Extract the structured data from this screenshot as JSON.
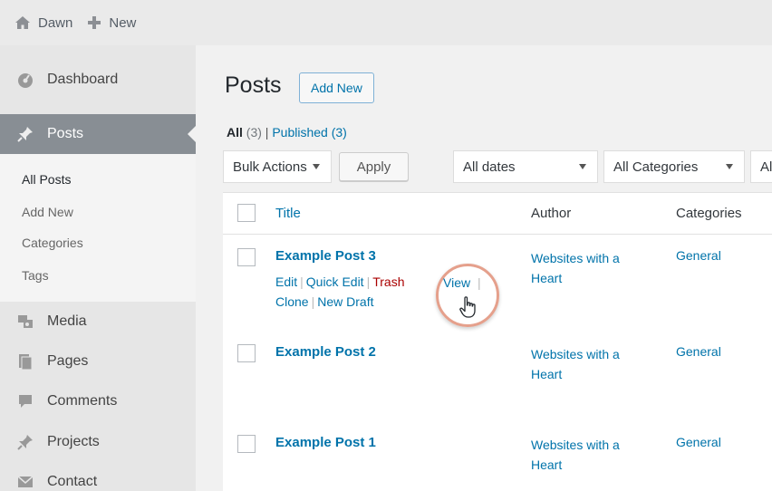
{
  "adminbar": {
    "site_name": "Dawn",
    "new_label": "New"
  },
  "sidebar": {
    "items": [
      {
        "label": "Dashboard",
        "icon": "dashboard-icon"
      },
      {
        "label": "Posts",
        "icon": "pin-icon",
        "current": true
      },
      {
        "label": "Media",
        "icon": "media-icon"
      },
      {
        "label": "Pages",
        "icon": "pages-icon"
      },
      {
        "label": "Comments",
        "icon": "comment-icon"
      },
      {
        "label": "Projects",
        "icon": "pin-icon"
      },
      {
        "label": "Contact",
        "icon": "mail-icon"
      }
    ],
    "submenu": [
      {
        "label": "All Posts",
        "current": true
      },
      {
        "label": "Add New"
      },
      {
        "label": "Categories"
      },
      {
        "label": "Tags"
      }
    ]
  },
  "main": {
    "title": "Posts",
    "add_new": "Add New",
    "views": {
      "all_label": "All",
      "all_count": "(3)",
      "separator": "|",
      "published_label": "Published",
      "published_count": "(3)"
    },
    "filters": {
      "bulk_actions": "Bulk Actions",
      "apply": "Apply",
      "dates": "All dates",
      "categories": "All Categories",
      "overflow": "Al"
    },
    "table": {
      "columns": [
        "Title",
        "Author",
        "Categories"
      ],
      "rows": [
        {
          "title": "Example Post 3",
          "actions": [
            "Edit",
            "Quick Edit",
            "Trash",
            "View",
            "Clone",
            "New Draft"
          ],
          "author_line1": "Websites with a",
          "author_line2": "Heart",
          "category": "General"
        },
        {
          "title": "Example Post 2",
          "author_line1": "Websites with a",
          "author_line2": "Heart",
          "category": "General"
        },
        {
          "title": "Example Post 1",
          "author_line1": "Websites with a",
          "author_line2": "Heart",
          "category": "General"
        }
      ]
    }
  },
  "colors": {
    "link": "#0073aa",
    "trash": "#aa0000",
    "highlight_ring": "#e5a08c"
  }
}
